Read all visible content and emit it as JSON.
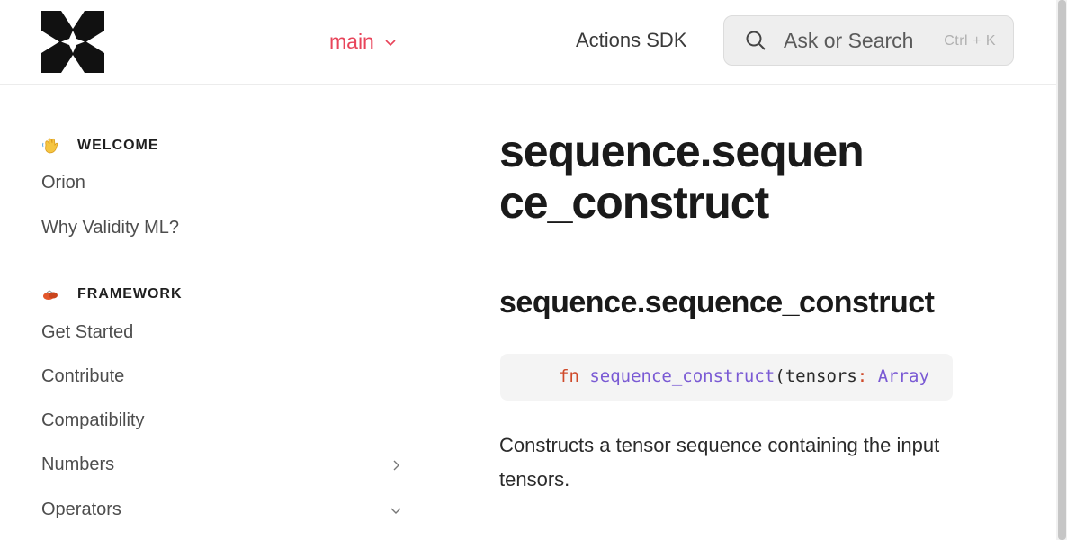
{
  "header": {
    "branch_label": "main",
    "sdk_link": "Actions SDK",
    "search": {
      "placeholder": "Ask or Search",
      "shortcut": "Ctrl + K"
    }
  },
  "sidebar": {
    "sections": [
      {
        "title": "WELCOME",
        "icon": "waving-hand-icon",
        "items": [
          {
            "label": "Orion"
          },
          {
            "label": "Why Validity ML?"
          }
        ]
      },
      {
        "title": "FRAMEWORK",
        "icon": "framework-emoji-icon",
        "items": [
          {
            "label": "Get Started"
          },
          {
            "label": "Contribute"
          },
          {
            "label": "Compatibility"
          },
          {
            "label": "Numbers",
            "chevron": "chevron-right-icon"
          },
          {
            "label": "Operators",
            "chevron": "chevron-down-icon"
          }
        ]
      }
    ]
  },
  "main": {
    "title": "sequence.sequence_construct",
    "heading": "sequence.sequence_construct",
    "code": {
      "keyword": "fn",
      "function": "sequence_construct",
      "open_paren": "(",
      "param": "tensors",
      "colon": ":",
      "type": "Array"
    },
    "description": "Constructs a tensor sequence containing the input tensors."
  },
  "colors": {
    "accent": "#e8445a",
    "keyword": "#cf4a2a",
    "function": "#7a5ad4"
  }
}
